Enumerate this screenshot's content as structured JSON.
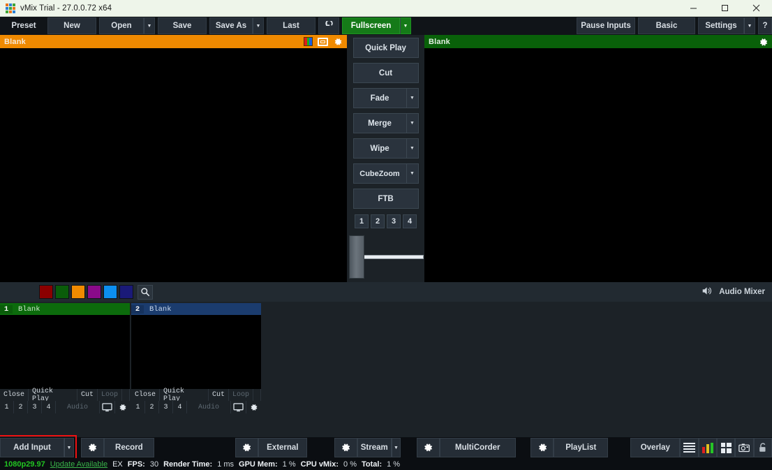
{
  "window": {
    "title": "vMix Trial - 27.0.0.72 x64",
    "controls": {
      "minimize": "minimize-icon",
      "maximize": "maximize-icon",
      "close": "close-icon"
    }
  },
  "toolbar": {
    "preset_label": "Preset",
    "new_label": "New",
    "open_label": "Open",
    "save_label": "Save",
    "save_as_label": "Save As",
    "last_label": "Last",
    "undo_icon": "undo-icon",
    "fullscreen_label": "Fullscreen",
    "pause_inputs_label": "Pause Inputs",
    "basic_label": "Basic",
    "settings_label": "Settings",
    "help_label": "?"
  },
  "preview": {
    "title": "Blank",
    "header_color": "#f08a00",
    "icons": [
      "color-bars-icon",
      "screen-icon",
      "gear-icon"
    ]
  },
  "program": {
    "title": "Blank",
    "header_color": "#096109",
    "icons": [
      "gear-icon"
    ]
  },
  "transitions": {
    "buttons": [
      {
        "label": "Quick Play",
        "has_dropdown": false
      },
      {
        "label": "Cut",
        "has_dropdown": false
      },
      {
        "label": "Fade",
        "has_dropdown": true
      },
      {
        "label": "Merge",
        "has_dropdown": true
      },
      {
        "label": "Wipe",
        "has_dropdown": true
      },
      {
        "label": "CubeZoom",
        "has_dropdown": true
      },
      {
        "label": "FTB",
        "has_dropdown": false
      }
    ],
    "numbers": [
      "1",
      "2",
      "3",
      "4"
    ],
    "tbar_value": 18
  },
  "input_bar": {
    "swatches": [
      "#8b0000",
      "#0a5c0a",
      "#f08a00",
      "#8a0a8a",
      "#0c8ff0",
      "#1a1a78"
    ],
    "search_icon": "search-icon",
    "audio_mixer_label": "Audio Mixer",
    "speaker_icon": "speaker-icon"
  },
  "inputs": [
    {
      "number": "1",
      "name": "Blank",
      "state": "program",
      "controls": [
        "Close",
        "Quick Play",
        "Cut",
        "Loop"
      ],
      "loop_disabled": true,
      "numbers": [
        "1",
        "2",
        "3",
        "4"
      ],
      "audio_label": "Audio",
      "audio_disabled": true,
      "icons": [
        "monitor-icon",
        "gear-icon"
      ]
    },
    {
      "number": "2",
      "name": "Blank",
      "state": "preview",
      "controls": [
        "Close",
        "Quick Play",
        "Cut",
        "Loop"
      ],
      "loop_disabled": true,
      "numbers": [
        "1",
        "2",
        "3",
        "4"
      ],
      "audio_label": "Audio",
      "audio_disabled": true,
      "icons": [
        "monitor-icon",
        "gear-icon"
      ]
    }
  ],
  "bottom_bar": {
    "add_input_label": "Add Input",
    "add_input_highlighted": true,
    "highlight_color": "#ee1111",
    "record_label": "Record",
    "external_label": "External",
    "stream_label": "Stream",
    "multicorder_label": "MultiCorder",
    "playlist_label": "PlayList",
    "overlay_label": "Overlay",
    "icons": [
      "hamburger-icon",
      "audio-meter-icon",
      "multiview-icon",
      "snapshot-icon",
      "lock-icon"
    ],
    "gear_icon": "gear-icon"
  },
  "status_bar": {
    "resolution": "1080p29.97",
    "update_link": "Update Available",
    "ex_label": "EX",
    "fps_key": "FPS:",
    "fps_value": "30",
    "render_key": "Render Time:",
    "render_value": "1 ms",
    "gpu_key": "GPU Mem:",
    "gpu_value": "1 %",
    "cpu_key": "CPU vMix:",
    "cpu_value": "0 %",
    "total_key": "Total:",
    "total_value": "1 %"
  }
}
